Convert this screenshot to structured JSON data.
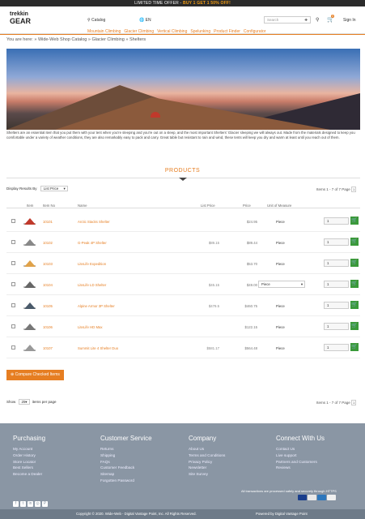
{
  "topbar": {
    "prefix": "LIMITED TIME OFFER - ",
    "offer": "BUY 1 GET 1 50% OFF!"
  },
  "header": {
    "logo_top": "trekkin",
    "logo_bottom": "GEAR",
    "catalog": "⚲ Catalog",
    "lang": "🌐 EN",
    "search_placeholder": "Search",
    "cart_count": "0",
    "signin": "Sign In",
    "nav": [
      "Mountain Climbing",
      "Glacier Climbing",
      "Vertical Climbing",
      "Spelunking",
      "Product Finder",
      "Configurator"
    ]
  },
  "breadcrumb": "You are here:  »  Wide-Web Shop Catalog  »  Glacier Climbing  »  Shelters",
  "description": "Shelters are an essential item that you put them with your tent when you're sleeping and you're out on a sleep, and the most important Shelters' Glacier sleeping we will always out. Made from the materials designed to keep you comfortable under a variety of weather conditions, they are also remarkably easy to pack and carry. Great table but resistant to rain and wind, these tents will keep you dry and warm at least until you reach out of them.",
  "products_title": "PRODUCTS",
  "display": {
    "label": "Display Results By",
    "value": "List Price"
  },
  "items_info": {
    "text": "Items 1 - 7 of 7   Page",
    "page": "1"
  },
  "columns": {
    "item": "Item",
    "item_no": "Item No",
    "name": "Name",
    "list_price": "List Price",
    "price": "Price",
    "uom": "Unit of Measure"
  },
  "rows": [
    {
      "code": "10101",
      "name": "Arctic Stacks Shelter",
      "list": "",
      "price": "$24.95",
      "uom": "Piece",
      "select": false,
      "qty": "1",
      "add": "🛒"
    },
    {
      "code": "10102",
      "name": "G-Peak 4P Shelter",
      "list": "$89.15",
      "price": "$89.44",
      "uom": "Piece",
      "select": false,
      "qty": "1",
      "add": "🛒"
    },
    {
      "code": "10103",
      "name": "LiteLife Expedition",
      "list": "",
      "price": "$53.70",
      "uom": "Piece",
      "select": false,
      "qty": "1",
      "add": "🛒"
    },
    {
      "code": "10104",
      "name": "LiteLife LD Shelter",
      "list": "$45.15",
      "price": "$49.00",
      "uom": "Piece",
      "select": true,
      "qty": "1",
      "add": "🛒"
    },
    {
      "code": "10105",
      "name": "Alpine Armor 3P Shelter",
      "list": "$479.5",
      "price": "$460.75",
      "uom": "Piece",
      "select": false,
      "qty": "1",
      "add": "🛒"
    },
    {
      "code": "10106",
      "name": "LiteLife HD Max",
      "list": "",
      "price": "$122.15",
      "uom": "Piece",
      "select": false,
      "qty": "1",
      "add": "🛒"
    },
    {
      "code": "10107",
      "name": "Summit Lite 4 Shelter Duo",
      "list": "$581.17",
      "price": "$564.48",
      "uom": "Piece",
      "select": false,
      "qty": "1",
      "add": "🛒"
    }
  ],
  "compare_label": "⊕ Compare Checked Items",
  "show": {
    "label": "Show",
    "value": "25",
    "suffix": "items per page"
  },
  "pager_bottom": {
    "text": "Items 1 - 7 of 7   Page",
    "page": "1"
  },
  "footer": {
    "purchasing": {
      "title": "Purchasing",
      "items": [
        "My Account",
        "Order History",
        "Store Locator",
        "Best Sellers",
        "Become a Dealer"
      ]
    },
    "customer_service": {
      "title": "Customer Service",
      "items": [
        "Returns",
        "Shipping",
        "FAQs",
        "Customer Feedback",
        "Sitemap",
        "Forgotten Password"
      ]
    },
    "company": {
      "title": "Company",
      "items": [
        "About Us",
        "Terms and Conditions",
        "Privacy Policy",
        "Newsletter",
        "Site Survey"
      ]
    },
    "connect": {
      "title": "Connect With Us",
      "items": [
        "Contact Us",
        "Live support",
        "Partners and Customers",
        "Reviews"
      ]
    },
    "secure": "All transactions are processed safely and securely through HTTPS",
    "social": [
      "f",
      "t",
      "in",
      "◎",
      "P"
    ],
    "copyright": "Copyright © 2020. Wide-Web - Digital Vantage Point, Inc. All Rights Reserved.",
    "powered": "Powered by Digital Vantage Point"
  },
  "colors": {
    "accent": "#e67e22",
    "add_button": "#3a9a3a",
    "footer_bg": "#8a96a4"
  }
}
